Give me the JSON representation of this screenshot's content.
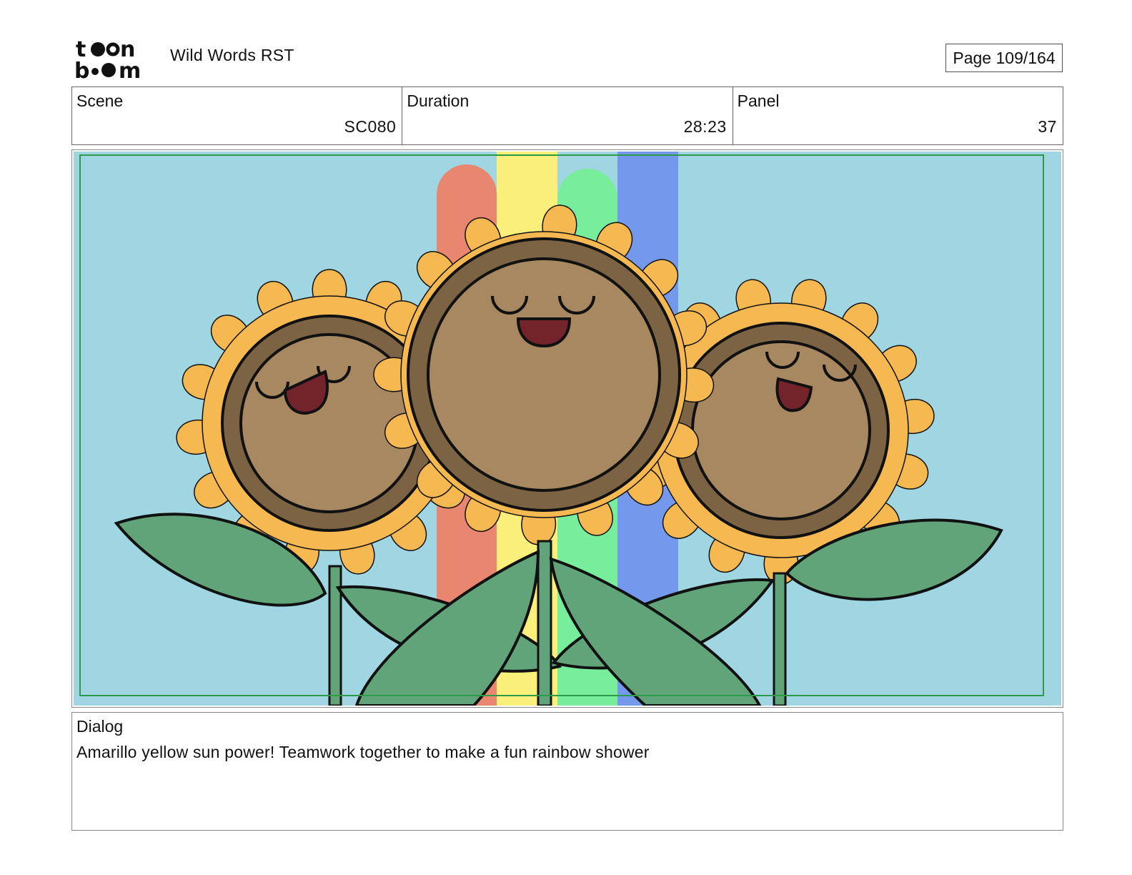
{
  "header": {
    "logo_text": "toon boom",
    "project_title": "Wild Words RST",
    "page_label": "Page 109/164"
  },
  "info": {
    "scene_label": "Scene",
    "scene_value": "SC080",
    "duration_label": "Duration",
    "duration_value": "28:23",
    "panel_label": "Panel",
    "panel_value": "37"
  },
  "panel": {
    "image_icon": "storyboard-panel-sunflowers-image",
    "colors": {
      "sky": "#9fd6e1",
      "rainbow": [
        "#e8866f",
        "#fbef7c",
        "#78ee9c",
        "#7499ec"
      ],
      "petal": "#f6b951",
      "seed_ring": "#7c6344",
      "face": "#a88860",
      "mouth": "#73232a",
      "leaf": "#62a47a",
      "safe_frame": "#2e9b4a"
    }
  },
  "dialog": {
    "label": "Dialog",
    "text": "Amarillo yellow sun power! Teamwork together to make a fun rainbow shower"
  }
}
